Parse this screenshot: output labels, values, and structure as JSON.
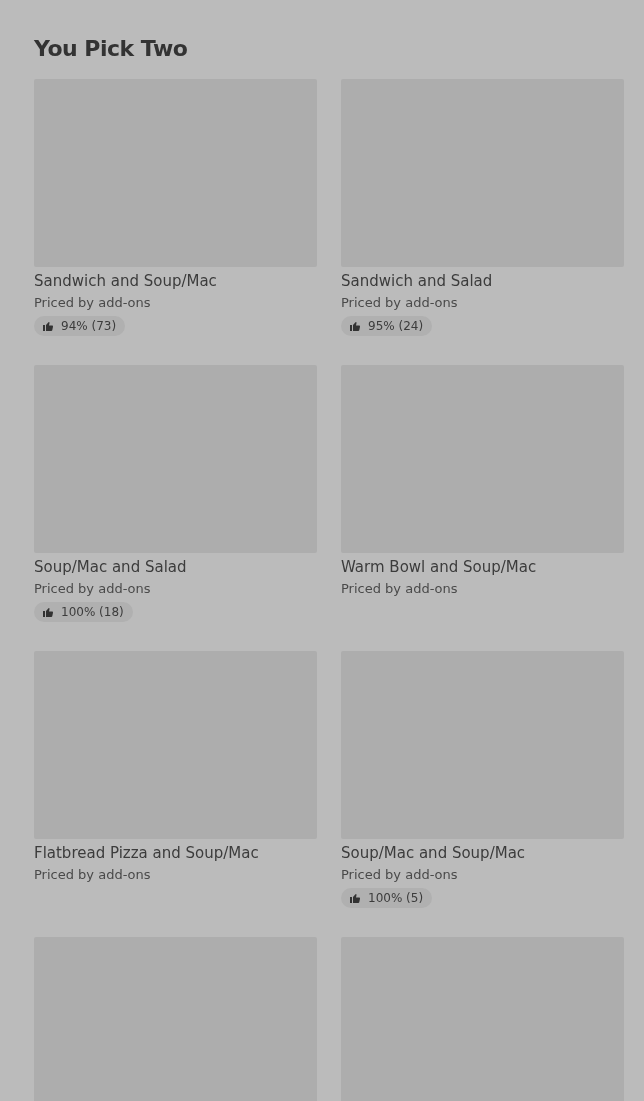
{
  "section": {
    "title": "You Pick Two"
  },
  "items": [
    {
      "kind": "card",
      "name": "Sandwich and Soup/Mac",
      "price": "Priced by add-ons",
      "rating": "94% (73)"
    },
    {
      "kind": "card",
      "name": "Sandwich and Salad",
      "price": "Priced by add-ons",
      "rating": "95% (24)"
    },
    {
      "kind": "card",
      "name": "Soup/Mac and Salad",
      "price": "Priced by add-ons",
      "rating": "100% (18)"
    },
    {
      "kind": "card",
      "name": "Warm Bowl and Soup/Mac",
      "price": "Priced by add-ons"
    },
    {
      "kind": "card",
      "name": "Flatbread Pizza and Soup/Mac",
      "price": "Priced by add-ons"
    },
    {
      "kind": "card",
      "name": "Soup/Mac and Soup/Mac",
      "price": "Priced by add-ons",
      "rating": "100% (5)"
    },
    {
      "kind": "image_only"
    },
    {
      "kind": "image_only"
    }
  ]
}
